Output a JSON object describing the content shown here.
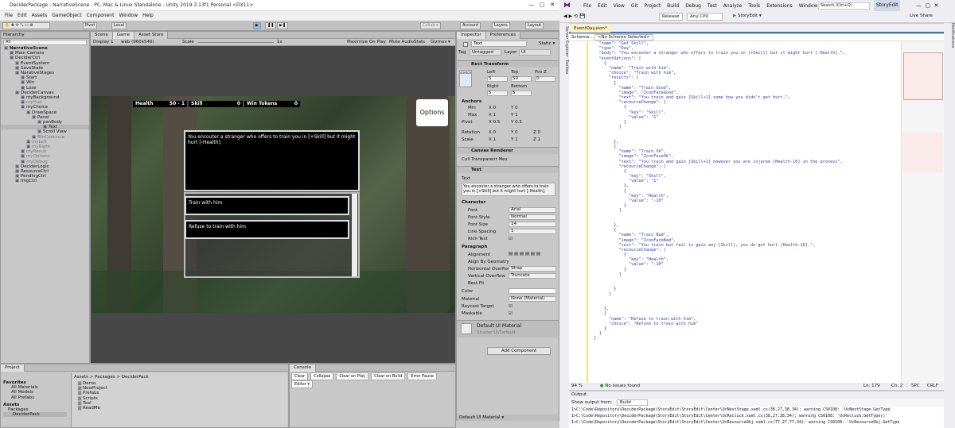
{
  "unity": {
    "title": "DeciderPackage - NarrativeScene - PC, Mac & Linux Standalone - Unity 2019.3.13f1 Personal <DX11>",
    "menu": [
      "File",
      "Edit",
      "Assets",
      "GameObject",
      "Component",
      "Window",
      "Help"
    ],
    "toolbar": {
      "pivot": "Pivot",
      "local": "Local",
      "collab": "Collab ▾",
      "account": "Account",
      "layers": "Layers",
      "layout": "Layout"
    },
    "hierarchy": {
      "tab": "Hierarchy",
      "search": "All",
      "items": [
        {
          "label": "NarrativeScene",
          "indent": 0,
          "bold": true
        },
        {
          "label": "Main Camera",
          "indent": 1
        },
        {
          "label": "DeciderCtrl",
          "indent": 1
        },
        {
          "label": "EventSystem",
          "indent": 2
        },
        {
          "label": "SaveState",
          "indent": 2
        },
        {
          "label": "NarativeStages",
          "indent": 2
        },
        {
          "label": "Start",
          "indent": 3
        },
        {
          "label": "Win",
          "indent": 3
        },
        {
          "label": "Lose",
          "indent": 3
        },
        {
          "label": "DeciderCanvas",
          "indent": 2
        },
        {
          "label": "myBackground",
          "indent": 3
        },
        {
          "label": "myHud",
          "indent": 3,
          "grey": true
        },
        {
          "label": "myChoice",
          "indent": 3
        },
        {
          "label": "DrawSpace",
          "indent": 4
        },
        {
          "label": "Panel",
          "indent": 5
        },
        {
          "label": "panBody",
          "indent": 6
        },
        {
          "label": "Text",
          "indent": 7,
          "sel": true
        },
        {
          "label": "Scroll View",
          "indent": 6
        },
        {
          "label": "BtnContinue",
          "indent": 5,
          "grey": true
        },
        {
          "label": "myLeft",
          "indent": 4,
          "grey": true
        },
        {
          "label": "myRight",
          "indent": 4,
          "grey": true
        },
        {
          "label": "myResult",
          "indent": 3,
          "grey": true
        },
        {
          "label": "myOptions",
          "indent": 3,
          "grey": true
        },
        {
          "label": "myDebug",
          "indent": 3,
          "grey": true
        },
        {
          "label": "DeciderLogic",
          "indent": 2
        },
        {
          "label": "ResourceCtrl",
          "indent": 2
        },
        {
          "label": "PendingCtrl",
          "indent": 2
        },
        {
          "label": "ImgCtrl",
          "indent": 2
        }
      ]
    },
    "scene_tabs": [
      "Scene",
      "Game",
      "Asset Store"
    ],
    "game_bar": {
      "display": "Display 1",
      "res": "web (960x540)",
      "scale_label": "Scale",
      "scale_val": "1x",
      "maximize": "Maximize On Play",
      "mute": "Mute Audio",
      "stats": "Stats",
      "gizmos": "Gizmos ▾"
    },
    "game": {
      "health_label": "Health",
      "health_val": "50 - 1",
      "skill_label": "Skill",
      "skill_val": "0",
      "win_label": "Win Tokens",
      "win_val": "0",
      "options": "Options",
      "body": "You encouter a stranger who offers to train you in [+Skill] but it might hurt [-Health].",
      "choice1": "Train with him",
      "choice2": "Refuse to train with him"
    },
    "inspector": {
      "tabs": [
        "Inspector",
        "Preferences"
      ],
      "obj_name": "Text",
      "static": "Static ▾",
      "tag": "Untagged",
      "layer": "UI",
      "rect": "Rect Transform",
      "stretch": "stretch",
      "left": "5",
      "top": "50",
      "posz": "0",
      "right": "5",
      "bottom": "5",
      "anchors": "Anchors",
      "min_x": "0",
      "min_y": "0",
      "max_x": "1",
      "max_y": "1",
      "pivot_x": "0.5",
      "pivot_y": "0.5",
      "rot_x": "0",
      "rot_y": "0",
      "rot_z": "0",
      "scale_x": "1",
      "scale_y": "1",
      "scale_z": "1",
      "canvas_renderer": "Canvas Renderer",
      "cull": "Cull Transparent Mes",
      "text_comp": "Text",
      "text_label": "Text",
      "text_val": "You encouter a stranger who offers to train you in [+Skill] but it might hurt [-Health].",
      "character": "Character",
      "font": "Arial",
      "font_style": "Normal",
      "font_size": "14",
      "line_spacing": "1",
      "paragraph": "Paragraph",
      "h_overflow": "Wrap",
      "v_overflow": "Truncate",
      "material": "None (Material)",
      "default_mat": "Default UI Material",
      "shader": "UI/Default",
      "add_component": "Add Component",
      "footer": "Default UI Material ▾"
    },
    "project": {
      "tabs": [
        "Project",
        "Console"
      ],
      "console_btns": [
        "Clear",
        "Collapse",
        "Clear on Play",
        "Clear on Build",
        "Error Pause",
        "Editor ▾"
      ],
      "favorites": [
        "Favorites",
        "All Materials",
        "All Models",
        "All Prefabs"
      ],
      "assets": [
        "Assets",
        "Packages",
        "DeciderPack"
      ],
      "crumb": "Assets > Packages > DeciderPack",
      "folders": [
        "Demo",
        "NewProject",
        "Prefabs",
        "Scripts",
        "Tool",
        "ReadMe"
      ]
    }
  },
  "vs": {
    "menu": [
      "File",
      "Edit",
      "View",
      "Git",
      "Project",
      "Build",
      "Debug",
      "Test",
      "Analyze",
      "Tools",
      "Extensions",
      "Window",
      "Help"
    ],
    "search": "Search (Ctrl+Q)",
    "solution": "StoryEdit",
    "config": "Release",
    "platform": "Any CPU",
    "run": "StoryEdit ▾",
    "liveshare": "Live Share",
    "side_left": [
      "Server Explorer",
      "Toolbox"
    ],
    "side_right": [
      "Notifications"
    ],
    "tab": "EventDay.json*",
    "schema_label": "Schema:",
    "schema_val": "<No Schema Selected>",
    "code": [
      "    \"name\": \"Get Skill\",",
      "    \"type\": \"Day\",",
      "    \"body\": \"You encouter a stranger who offers to train you in [+Skill] but it might hurt [-Health].\",",
      "    \"eventOptions\": [",
      "      {",
      "        \"name\": \"Train with him\",",
      "        \"choice\": \"Train with him\",",
      "        \"results\": [",
      "          {",
      "            \"name\": \"Train Good\",",
      "            \"image\": \"IconFaceGood\",",
      "            \"text\": \"You train and gain [Skill+1] some how you didn't get hurt.\",",
      "            \"recourceChange\": [",
      "              {",
      "                \"key\": \"Skill\",",
      "                \"value\": \"1\"",
      "              }",
      "            ]",
      "",
      "",
      "          },",
      "          {",
      "            \"name\": \"Train Ok\",",
      "            \"image\": \"IconFaceOk\",",
      "            \"text\": \"You train and gain [Skill+1] however you are injured [Health-10] in the process\",",
      "            \"recourceChange\": [",
      "              {",
      "                \"key\": \"Skill\",",
      "                \"value\": \"1\"",
      "              },",
      "              {",
      "                \"key\": \"Health\",",
      "                \"value\": \"-10\"",
      "              }",
      "            ]",
      "",
      "",
      "          },",
      "          {",
      "            \"name\": \"Train Bad\",",
      "            \"image\": \"IconFaceBad\",",
      "            \"text\": \"You train but fail to gain any [Skill], you do get hurt [Health-10].\",",
      "            \"recourceChange\": [",
      "              {",
      "                \"key\": \"Health\",",
      "                \"value\": \"-10\"",
      "              }",
      "            ]",
      "",
      "",
      "          }",
      "        ]",
      "",
      "",
      "      },",
      "      {",
      "        \"name\": \"Refuse to train with him\",",
      "        \"choice\": \"Refuse to train with him\"",
      "      }",
      "    ]",
      "  }"
    ],
    "status": {
      "zoom": "94 %",
      "issues": "No issues found",
      "ln": "Ln: 179",
      "ch": "Ch: 2",
      "spc": "SPC",
      "crlf": "CRLF"
    },
    "output": {
      "title": "Output",
      "show_from": "Show output from:",
      "source": "Build",
      "lines": [
        "1>C:\\Code\\Repository\\DeciderPackage\\StoryEdit\\StoryEdit\\Center\\UcNextStage.xaml.cs(38,27,38,34): warning CS0108: 'UcNextStage.GetType'",
        "1>C:\\Code\\Repository\\DeciderPackage\\StoryEdit\\StoryEdit\\Center\\UcRecluck.xaml.cs(38,27,38,34): warning CS0108: 'UcRecluck.GetType()'",
        "1>C:\\Code\\Repository\\DeciderPackage\\StoryEdit\\StoryEdit\\Center\\UcResourceObj.xaml.cs(77,27,77,34): warning CS0108: 'UcResourceObj.GetType"
      ]
    }
  }
}
